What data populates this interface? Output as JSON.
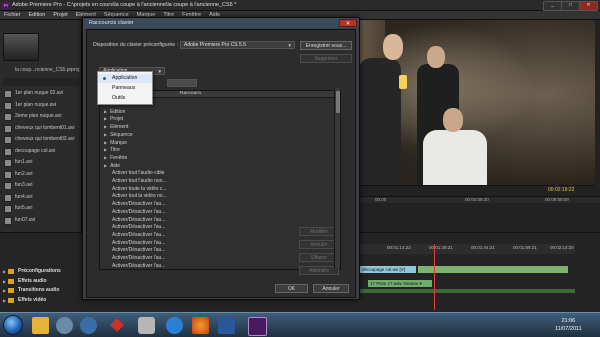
{
  "window": {
    "title": "Adobe Premiere Pro - C:\\projets en cours\\la coupe à l'ancienne\\la coupe à l'ancienne_CS5 *",
    "logo": "Pr",
    "minimize": "_",
    "maximize": "□",
    "close": "✕"
  },
  "menu": [
    "Fichier",
    "Edition",
    "Projet",
    "Elément",
    "Séquence",
    "Marque",
    "Titre",
    "Fenêtre",
    "Aide"
  ],
  "project": {
    "name": "la coup...ncienne_CS5.prproj",
    "items": [
      "1er plan nuque 02.avi",
      "1er plan nuque.avi",
      "2eme plan nuque.avi",
      "cheveux qui tombent01.avi",
      "cheveux qui tombent02.avi",
      "decoupage col.avi",
      "fun1.avi",
      "fun2.avi",
      "fun3.avi",
      "fun4.avi",
      "fun5.avi",
      "fun07.avi"
    ]
  },
  "effects": {
    "items": [
      "Préconfigurations",
      "Effets audio",
      "Transitions audio",
      "Effets vidéo"
    ]
  },
  "program": {
    "timecode": "00:02:19:22",
    "ruler": [
      "00:00",
      "00:04:59:20",
      "00:09:59:09"
    ]
  },
  "timeline": {
    "ruler": [
      "19:22",
      "00:01:14:22",
      "00:01:29:21",
      "00:01:44:21",
      "00:01:59:21",
      "00:02:14:20"
    ],
    "clip_video": "découpage col.avi [V]",
    "clip_audio": "17 Piste 17.wav :Niveau ▾"
  },
  "dialog": {
    "title": "Raccourcis clavier",
    "close": "✕",
    "preset_label": "Disposition du clavier préconfigurée :",
    "preset_value": "Adobe Premiere Pro CS 5.5",
    "save_as": "Enregistrer sous...",
    "delete": "Supprimer",
    "category_value": "Application",
    "column_header": "Raccourci",
    "items": [
      {
        "label": "Fichier",
        "tree": true
      },
      {
        "label": "Edition",
        "tree": true
      },
      {
        "label": "Projet",
        "tree": true
      },
      {
        "label": "Elément",
        "tree": true
      },
      {
        "label": "Séquence",
        "tree": true
      },
      {
        "label": "Marque",
        "tree": true
      },
      {
        "label": "Titre",
        "tree": true
      },
      {
        "label": "Fenêtre",
        "tree": true
      },
      {
        "label": "Aide",
        "tree": true
      },
      {
        "label": "Activer tout l'audio cible",
        "tree": false
      },
      {
        "label": "Activer tout l'audio non...",
        "tree": false
      },
      {
        "label": "Activer toute la vidéo c...",
        "tree": false
      },
      {
        "label": "Activer tout la vidéo no...",
        "tree": false
      },
      {
        "label": "Activer/Désactiver l'au...",
        "tree": false
      },
      {
        "label": "Activer/Désactiver l'au...",
        "tree": false
      },
      {
        "label": "Activer/Désactiver l'au...",
        "tree": false
      },
      {
        "label": "Activer/Désactiver l'au...",
        "tree": false
      },
      {
        "label": "Activer/Désactiver l'au...",
        "tree": false
      },
      {
        "label": "Activer/Désactiver l'au...",
        "tree": false
      },
      {
        "label": "Activer/Désactiver l'au...",
        "tree": false
      },
      {
        "label": "Activer/Désactiver l'au...",
        "tree": false
      },
      {
        "label": "Activer/Désactiver l'au...",
        "tree": false
      }
    ],
    "side_buttons": [
      "Modifier",
      "Annuler",
      "Effacer",
      "Atteindre"
    ],
    "ok": "OK",
    "cancel": "Annuler"
  },
  "popup": {
    "items": [
      "Application",
      "Panneaux",
      "Outils"
    ],
    "selected": 0
  },
  "taskbar": {
    "time": "21:06",
    "date": "11/07/2011"
  }
}
